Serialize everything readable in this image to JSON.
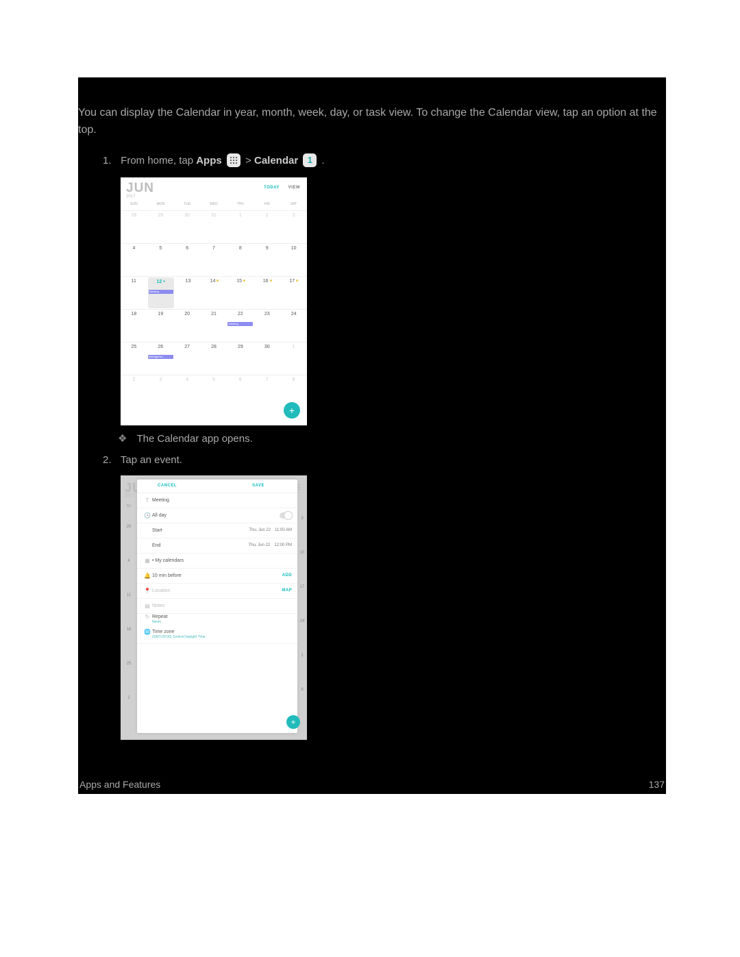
{
  "intro": "You can display the Calendar in year, month, week, day, or task view. To change the Calendar view, tap an option at the top.",
  "step1": {
    "num": "1.",
    "pre": "From home, tap ",
    "apps": "Apps",
    "sep": " > ",
    "cal": "Calendar",
    "end": "."
  },
  "bullet1": "The Calendar app opens.",
  "step2": {
    "num": "2.",
    "text": "Tap an event."
  },
  "footer": {
    "section": "Apps and Features",
    "page": "137"
  },
  "cal_icon_text": "1",
  "month_view": {
    "month": "JUN",
    "year": "2017",
    "today_label": "TODAY",
    "view_label": "VIEW",
    "weekdays": [
      "SUN",
      "MON",
      "TUE",
      "WED",
      "THU",
      "FRI",
      "SAT"
    ],
    "rows": [
      {
        "faded": true,
        "cells": [
          {
            "d": "28"
          },
          {
            "d": "29"
          },
          {
            "d": "30"
          },
          {
            "d": "31"
          },
          {
            "d": "1",
            "faded": false
          },
          {
            "d": "2",
            "faded": false
          },
          {
            "d": "3",
            "faded": false
          }
        ]
      },
      {
        "cells": [
          {
            "d": "4"
          },
          {
            "d": "5"
          },
          {
            "d": "6"
          },
          {
            "d": "7"
          },
          {
            "d": "8"
          },
          {
            "d": "9"
          },
          {
            "d": "10"
          }
        ]
      },
      {
        "cells": [
          {
            "d": "11"
          },
          {
            "d": "12",
            "selected": true,
            "event": "Meeting",
            "dot": "g"
          },
          {
            "d": "13"
          },
          {
            "d": "14",
            "dot": "y"
          },
          {
            "d": "15",
            "dot": "y"
          },
          {
            "d": "16",
            "dot": "y"
          },
          {
            "d": "17",
            "dot": "y"
          }
        ]
      },
      {
        "cells": [
          {
            "d": "18"
          },
          {
            "d": "19"
          },
          {
            "d": "20"
          },
          {
            "d": "21"
          },
          {
            "d": "22",
            "event": "Meeting"
          },
          {
            "d": "23"
          },
          {
            "d": "24"
          }
        ]
      },
      {
        "cells": [
          {
            "d": "25"
          },
          {
            "d": "26",
            "event": "Manageme..."
          },
          {
            "d": "27"
          },
          {
            "d": "28"
          },
          {
            "d": "29"
          },
          {
            "d": "30"
          },
          {
            "d": "1",
            "faded": true
          }
        ]
      },
      {
        "faded": true,
        "cells": [
          {
            "d": "2"
          },
          {
            "d": "3"
          },
          {
            "d": "4"
          },
          {
            "d": "5"
          },
          {
            "d": "6"
          },
          {
            "d": "7"
          },
          {
            "d": "8"
          }
        ]
      }
    ],
    "fab": "+"
  },
  "event_edit": {
    "bg_month": "JU",
    "bg_year": "2017",
    "bg_left_header": "SU",
    "bg_left_days": [
      "28",
      "4",
      "11",
      "18",
      "25",
      "2"
    ],
    "bg_right_days": [
      "3",
      "10",
      "17",
      "24",
      "1",
      "8"
    ],
    "ew_label": "EW",
    "cancel": "CANCEL",
    "save": "SAVE",
    "title": "Meeting",
    "allday": "All day",
    "start": {
      "label": "Start",
      "date": "Thu, Jun 22",
      "time": "11:00 AM"
    },
    "end": {
      "label": "End",
      "date": "Thu, Jun 22",
      "time": "12:00 PM"
    },
    "calendar_row": "• My calendars",
    "reminder": {
      "label": "10 min before",
      "action": "ADD"
    },
    "location": {
      "label": "Location",
      "action": "MAP"
    },
    "notes": "Notes",
    "repeat": {
      "label": "Repeat",
      "value": "Never"
    },
    "timezone": {
      "label": "Time zone",
      "value": "(GMT-05:00) Central Daylight Time"
    },
    "fab": "+"
  }
}
